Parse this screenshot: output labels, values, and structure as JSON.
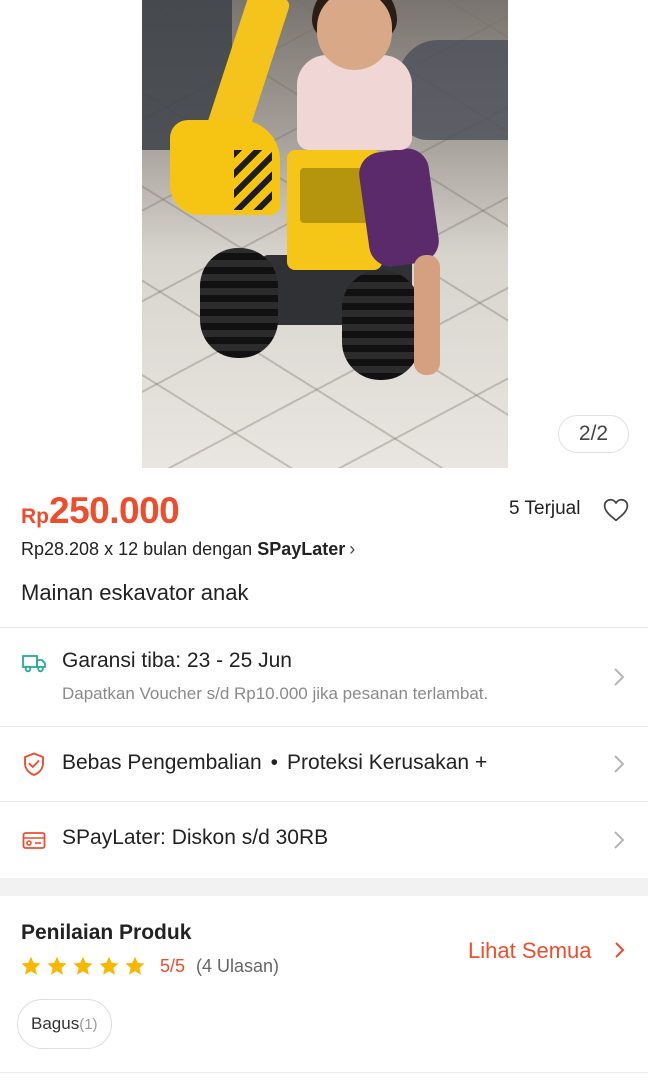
{
  "gallery": {
    "counter": "2/2",
    "image_description_icon": "product-photo"
  },
  "product": {
    "currency": "Rp",
    "price": "250.000",
    "sold": "5 Terjual",
    "installment_prefix": "Rp28.208 x 12 bulan dengan ",
    "installment_brand": "SPayLater",
    "installment_chevron": "›",
    "title": "Mainan eskavator anak"
  },
  "shipping": {
    "icon": "truck-icon",
    "title": "Garansi tiba: 23 - 25 Jun",
    "subtitle": "Dapatkan Voucher s/d Rp10.000 jika pesanan terlambat."
  },
  "protection": {
    "icon": "shield-icon",
    "item1": "Bebas Pengembalian",
    "separator": "•",
    "item2": "Proteksi Kerusakan +"
  },
  "promo": {
    "icon": "voucher-icon",
    "label": "SPayLater: Diskon s/d 30RB"
  },
  "reviews": {
    "title": "Penilaian Produk",
    "score": "5/5",
    "count": "(4 Ulasan)",
    "see_all": "Lihat Semua",
    "chip_label": "Bagus",
    "chip_count": "(1)",
    "star_rating": 5
  },
  "colors": {
    "accent": "#ee4d2d",
    "star": "#f8b700",
    "teal_icon": "#26aa99"
  }
}
